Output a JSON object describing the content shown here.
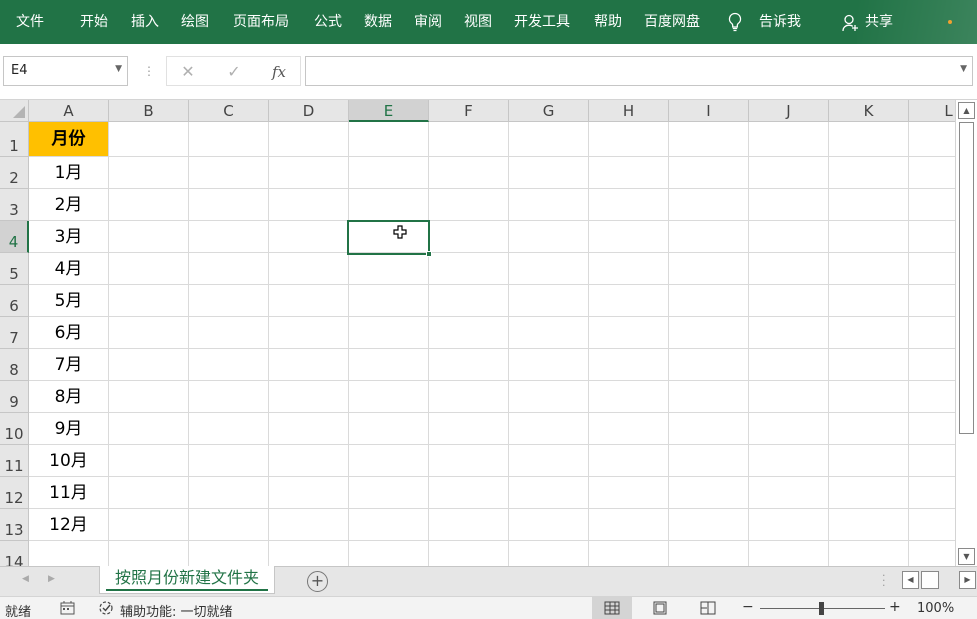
{
  "ribbon": {
    "tabs": [
      "文件",
      "开始",
      "插入",
      "绘图",
      "页面布局",
      "公式",
      "数据",
      "审阅",
      "视图",
      "开发工具",
      "帮助",
      "百度网盘"
    ],
    "tell_me": "告诉我",
    "share": "共享",
    "accent_color": "#217346"
  },
  "formula_bar": {
    "name_box": "E4",
    "cancel_icon": "✕",
    "enter_icon": "✓",
    "fx_label": "fx",
    "formula_value": ""
  },
  "grid": {
    "columns": [
      "A",
      "B",
      "C",
      "D",
      "E",
      "F",
      "G",
      "H",
      "I",
      "J",
      "K",
      "L"
    ],
    "rows": [
      "1",
      "2",
      "3",
      "4",
      "5",
      "6",
      "7",
      "8",
      "9",
      "10",
      "11",
      "12",
      "13",
      "14"
    ],
    "active_cell": "E4",
    "column_a": [
      "月份",
      "1月",
      "2月",
      "3月",
      "4月",
      "5月",
      "6月",
      "7月",
      "8月",
      "9月",
      "10月",
      "11月",
      "12月",
      ""
    ],
    "header_fill_color": "#ffc000"
  },
  "sheets": {
    "tabs": [
      "按照月份新建文件夹"
    ],
    "active": 0
  },
  "status": {
    "ready": "就绪",
    "accessibility": "辅助功能: 一切就绪",
    "zoom_minus": "−",
    "zoom_plus": "+",
    "zoom": "100%"
  }
}
